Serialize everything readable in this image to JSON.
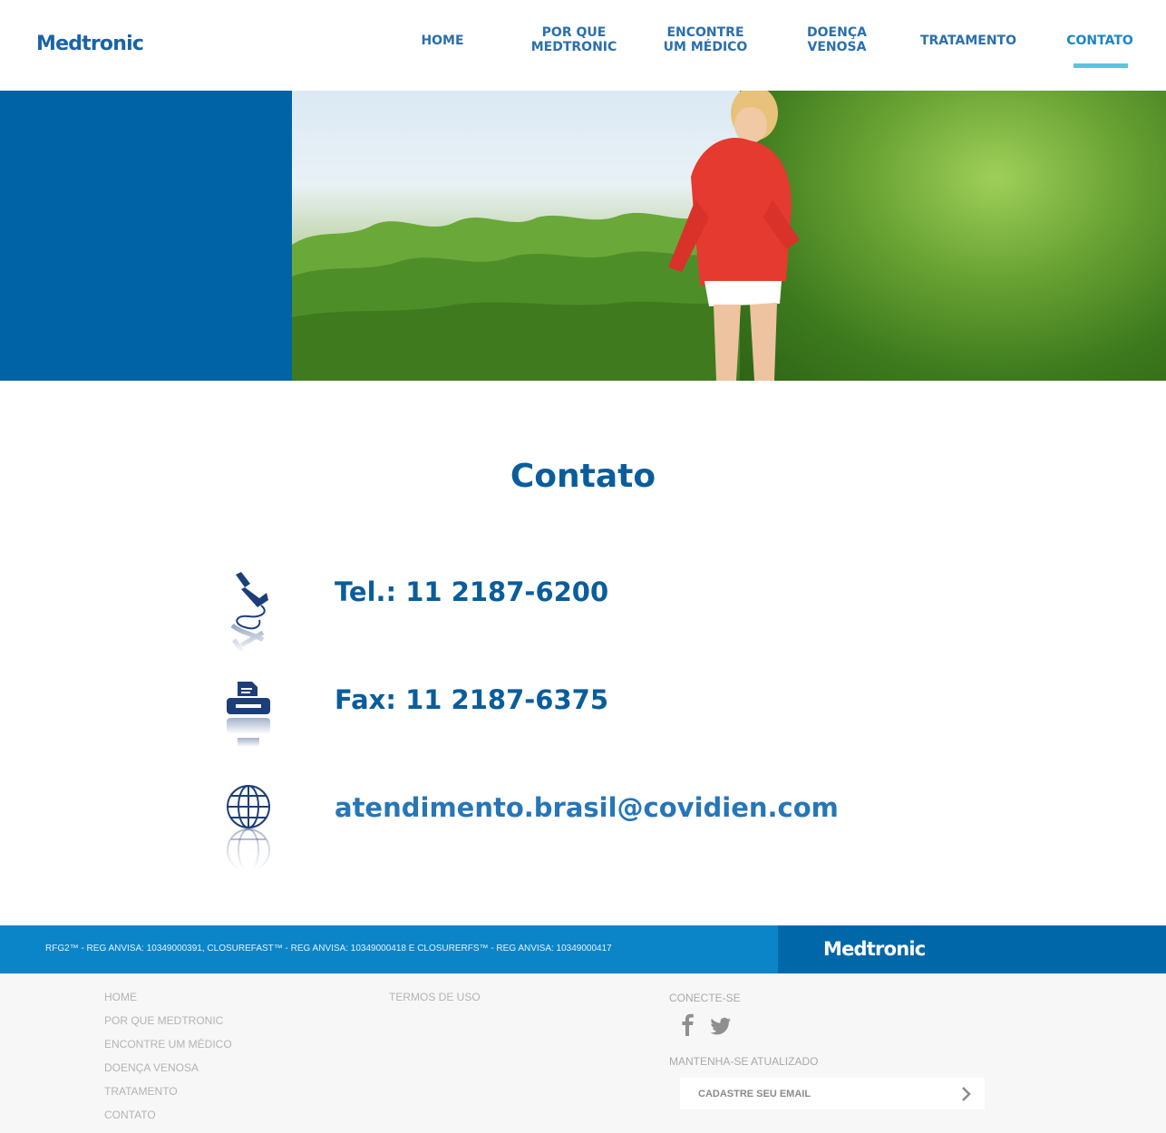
{
  "header": {
    "logo_text": "Medtronic",
    "nav": [
      {
        "line1": "HOME",
        "line2": ""
      },
      {
        "line1": "POR QUE",
        "line2": "MEDTRONIC"
      },
      {
        "line1": "ENCONTRE",
        "line2": "UM MÉDICO"
      },
      {
        "line1": "DOENÇA",
        "line2": "VENOSA"
      },
      {
        "line1": "TRATAMENTO",
        "line2": ""
      },
      {
        "line1": "CONTATO",
        "line2": ""
      }
    ],
    "active_nav": "CONTATO"
  },
  "main": {
    "title": "Contato",
    "contacts": [
      {
        "icon": "phone-icon",
        "text": "Tel.: 11 2187-6200"
      },
      {
        "icon": "fax-icon",
        "text": "Fax: 11 2187-6375"
      },
      {
        "icon": "globe-icon",
        "text": "atendimento.brasil@covidien.com"
      }
    ]
  },
  "footer_band": {
    "reg_text": "RFG2™ - REG ANVISA: 10349000391, CLOSUREFAST™ - REG ANVISA: 10349000418 E CLOSURERFS™ - REG ANVISA: 10349000417",
    "logo_text": "Medtronic"
  },
  "footer": {
    "links_col1": [
      "HOME",
      "POR QUE MEDTRONIC",
      "ENCONTRE UM MÉDICO",
      "DOENÇA VENOSA",
      "TRATAMENTO",
      "CONTATO"
    ],
    "links_col2": [
      "TERMOS DE USO"
    ],
    "connect_heading": "CONECTE-SE",
    "social": [
      "facebook-icon",
      "twitter-icon"
    ],
    "newsletter_heading": "MANTENHA-SE ATUALIZADO",
    "email_placeholder": "CADASTRE SEU EMAIL"
  },
  "colors": {
    "brand_blue": "#0063a5",
    "nav_text": "#2a6fae",
    "active_underline": "#5bc4de",
    "footer_band": "#0c85c8"
  }
}
